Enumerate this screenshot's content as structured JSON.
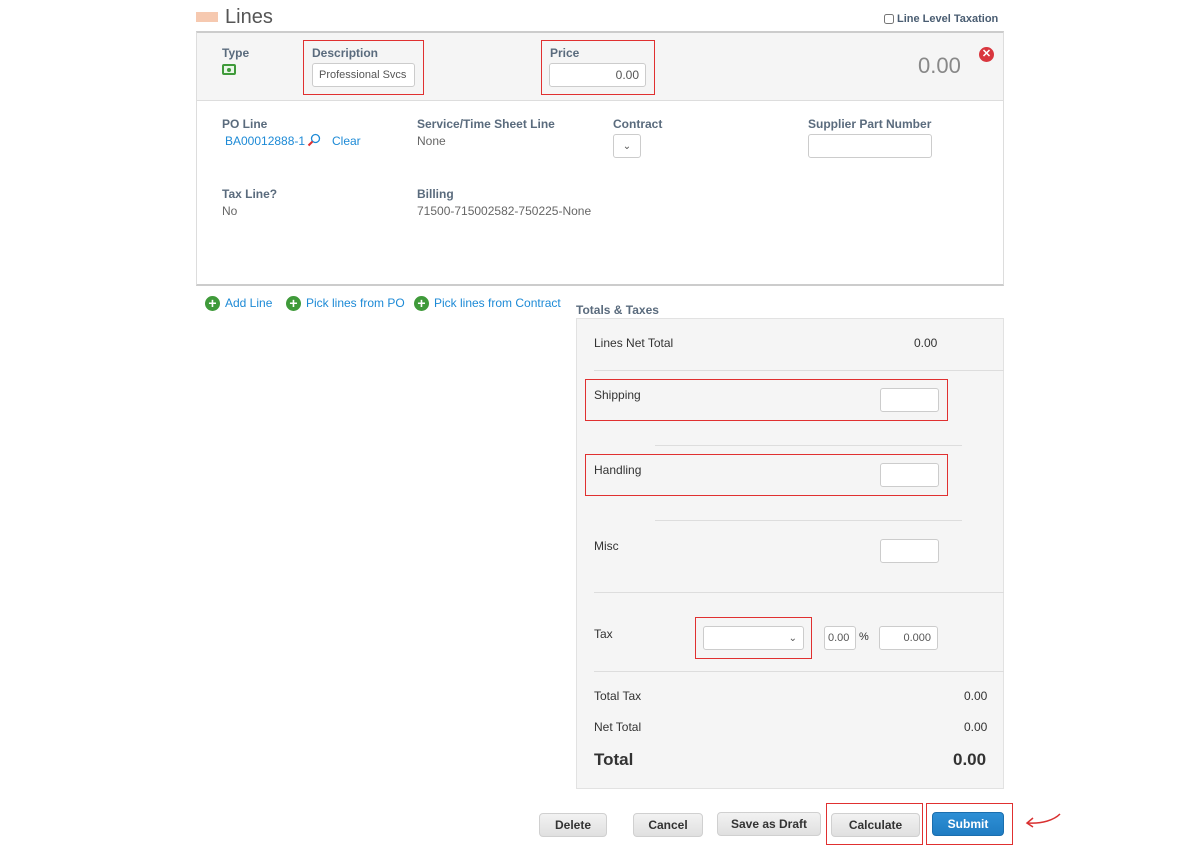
{
  "section": {
    "title": "Lines",
    "line_level_taxation_label": "Line Level Taxation",
    "line_level_taxation_checked": false
  },
  "line": {
    "type_label": "Type",
    "type_icon": "money-icon",
    "description_label": "Description",
    "description_value": "Professional Svcs",
    "price_label": "Price",
    "price_value": "0.00",
    "line_total": "0.00",
    "po_line_label": "PO Line",
    "po_line_value": "BA00012888-1",
    "po_clear": "Clear",
    "service_label": "Service/Time Sheet Line",
    "service_value": "None",
    "contract_label": "Contract",
    "supplier_part_label": "Supplier Part Number",
    "supplier_part_value": "",
    "tax_line_label": "Tax Line?",
    "tax_line_value": "No",
    "billing_label": "Billing",
    "billing_value": "71500-715002582-750225-None"
  },
  "actions": {
    "add_line": "Add Line",
    "pick_po": "Pick lines from PO",
    "pick_contract": "Pick lines from Contract"
  },
  "totals": {
    "title": "Totals & Taxes",
    "lines_net_total_label": "Lines Net Total",
    "lines_net_total_value": "0.00",
    "shipping_label": "Shipping",
    "shipping_value": "",
    "handling_label": "Handling",
    "handling_value": "",
    "misc_label": "Misc",
    "misc_value": "",
    "tax_label": "Tax",
    "tax_select_value": "",
    "tax_rate": "0.00",
    "tax_percent_sign": "%",
    "tax_amount": "0.000",
    "total_tax_label": "Total Tax",
    "total_tax_value": "0.00",
    "net_total_label": "Net Total",
    "net_total_value": "0.00",
    "total_label": "Total",
    "total_value": "0.00"
  },
  "buttons": {
    "delete": "Delete",
    "cancel": "Cancel",
    "save_draft": "Save as Draft",
    "calculate": "Calculate",
    "submit": "Submit"
  },
  "colors": {
    "accent": "#1f7cc2",
    "highlight": "#e03030",
    "link": "#1d8ad6",
    "add": "#3f9a3a"
  }
}
